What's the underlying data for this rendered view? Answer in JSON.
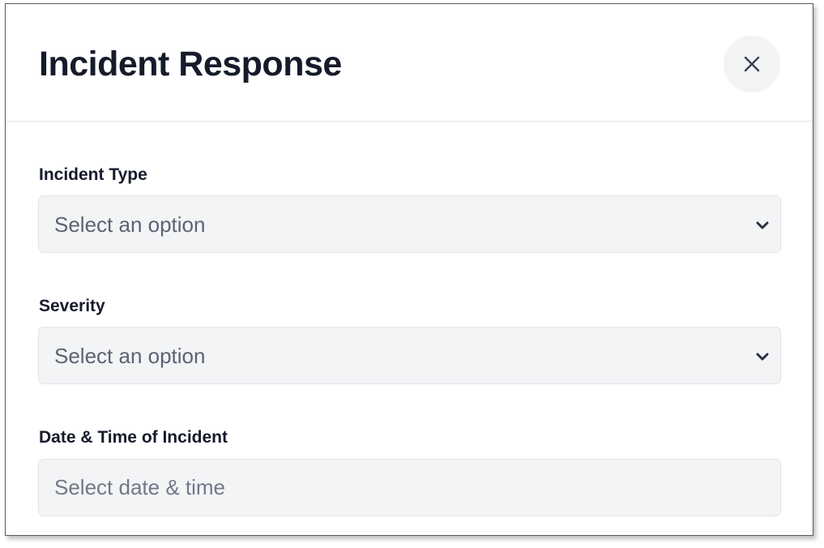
{
  "dialog": {
    "title": "Incident Response",
    "close_icon": "close-icon"
  },
  "form": {
    "incident_type": {
      "label": "Incident Type",
      "value": "Select an option"
    },
    "severity": {
      "label": "Severity",
      "value": "Select an option"
    },
    "datetime": {
      "label": "Date & Time of Incident",
      "placeholder": "Select date & time"
    }
  },
  "colors": {
    "title": "#161b2b",
    "field_bg": "#f3f4f6",
    "placeholder": "#737888",
    "close_bg": "#f2f3f5"
  }
}
